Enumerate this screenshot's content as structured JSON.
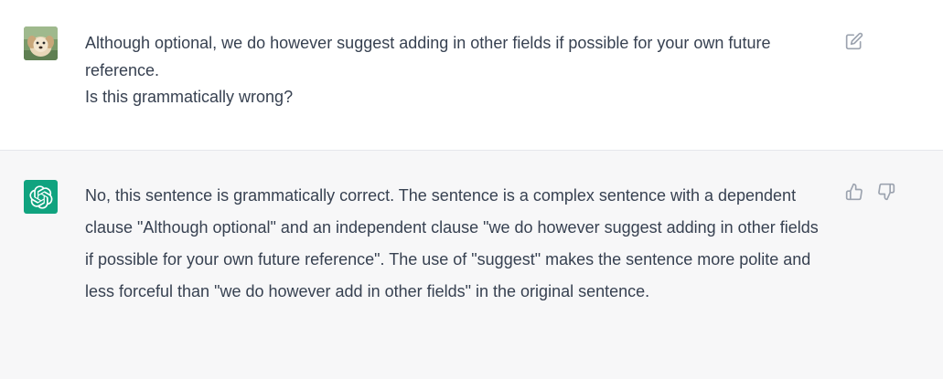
{
  "user_message": {
    "avatar_icon": "dog-avatar",
    "lines": [
      "Although optional, we do however suggest adding in other fields if possible for your own future reference.",
      "Is this grammatically wrong?"
    ],
    "edit_icon": "edit-icon"
  },
  "assistant_message": {
    "avatar_icon": "openai-logo-icon",
    "avatar_color": "#10a37f",
    "text": "No, this sentence is grammatically correct. The sentence is a complex sentence with a dependent clause \"Although optional\" and an independent clause \"we do however suggest adding in other fields if possible for your own future reference\". The use of \"suggest\" makes the sentence more polite and less forceful than \"we do however add in other fields\" in the original sentence.",
    "thumbs_up_icon": "thumbs-up-icon",
    "thumbs_down_icon": "thumbs-down-icon"
  }
}
